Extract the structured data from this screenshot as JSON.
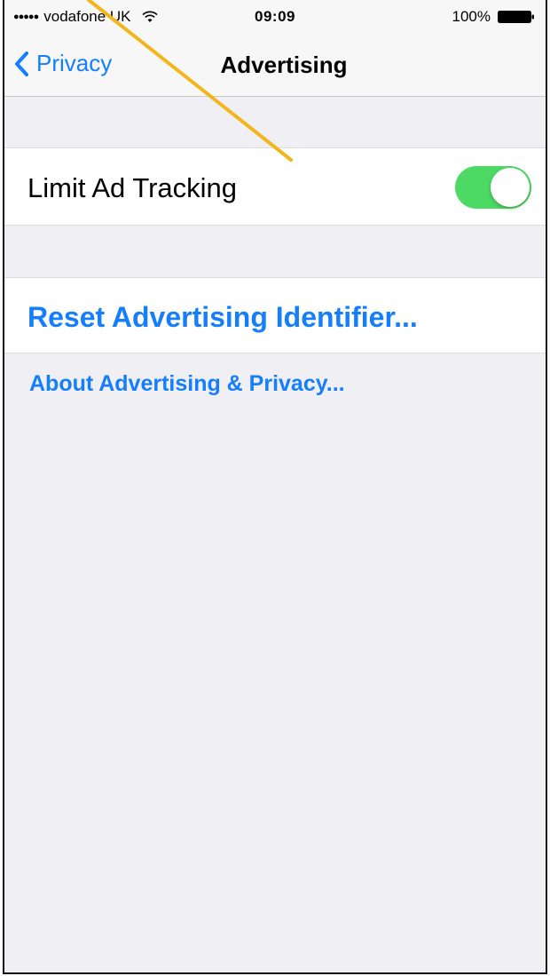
{
  "status_bar": {
    "signal": "●●●●●",
    "carrier": "vodafone UK",
    "time": "09:09",
    "battery": "100%"
  },
  "nav": {
    "back_label": "Privacy",
    "title": "Advertising"
  },
  "settings": {
    "limit_ad_tracking": {
      "label": "Limit Ad Tracking",
      "enabled": true
    },
    "reset_identifier_label": "Reset Advertising Identifier...",
    "about_link_label": "About Advertising & Privacy..."
  },
  "colors": {
    "accent": "#157efb",
    "toggle_on": "#4cd964",
    "background": "#efeff4",
    "annotation_arrow": "#f2b51b"
  }
}
